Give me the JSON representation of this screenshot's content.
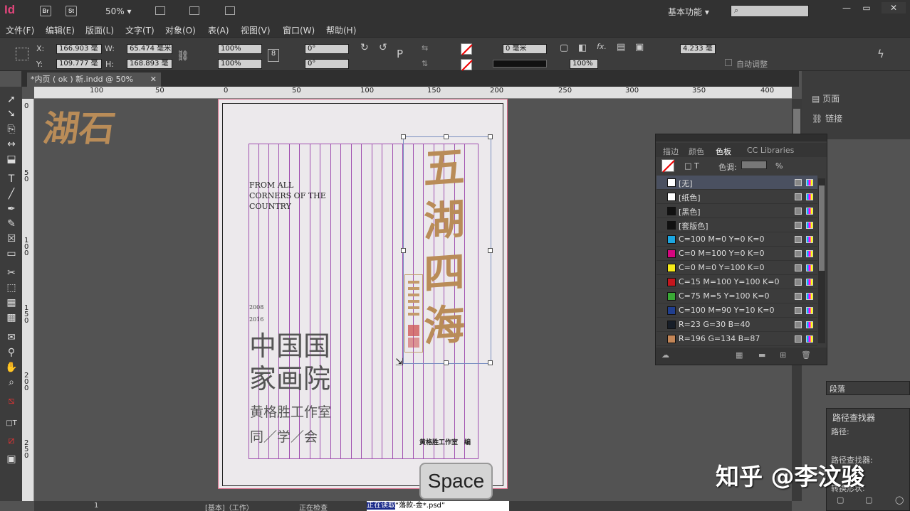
{
  "app": {
    "logo": "Id",
    "bridge": "Br",
    "stock": "St",
    "zoom": "50%",
    "workspace": "基本功能",
    "win_min": "—",
    "win_max": "▭",
    "win_close": "✕"
  },
  "menu": [
    "文件(F)",
    "编辑(E)",
    "版面(L)",
    "文字(T)",
    "对象(O)",
    "表(A)",
    "视图(V)",
    "窗口(W)",
    "帮助(H)"
  ],
  "control": {
    "x_label": "X:",
    "x": "166.903 毫",
    "y_label": "Y:",
    "y": "109.777 毫",
    "w_label": "W:",
    "w": "65.474 毫米",
    "h_label": "H:",
    "h": "168.893 毫",
    "scale_x": "100%",
    "scale_y": "100%",
    "rotate": "0°",
    "shear": "0°",
    "stroke": "0 毫米",
    "opacity": "100%",
    "fx": "fx.",
    "frame_w": "4.233 毫",
    "auto_fit": "自动调整"
  },
  "tab": {
    "title": "*内页 ( ok ) 新.indd @ 50%",
    "close": "✕"
  },
  "ruler_h": [
    "100",
    "50",
    "0",
    "50",
    "100",
    "150",
    "200",
    "250",
    "300",
    "350",
    "400"
  ],
  "ruler_v": [
    "0",
    "50",
    "100",
    "150",
    "200",
    "250"
  ],
  "doc": {
    "calligraphy_left": "湖石",
    "en_line1": "FROM ALL",
    "en_line2": "CORNERS OF THE",
    "en_line3": "COUNTRY",
    "year1": "2008",
    "year2": "2016",
    "title1": "中国国",
    "title2": "家画院",
    "studio": "黄格胜工作室",
    "classmates": "同／学／会",
    "editor": "黄格胜工作室　编",
    "calligraphy_right": "五湖四海"
  },
  "dock": {
    "pages": "页面",
    "links": "链接"
  },
  "swatches": {
    "tabs": [
      "描边",
      "颜色",
      "色板",
      "CC Libraries"
    ],
    "tint_label": "色调:",
    "pct": "%",
    "tint_icon": "T",
    "items": [
      {
        "name": "[无]",
        "color": "#ffffff"
      },
      {
        "name": "[纸色]",
        "color": "#ffffff"
      },
      {
        "name": "[黑色]",
        "color": "#111111"
      },
      {
        "name": "[套版色]",
        "color": "#111111"
      },
      {
        "name": "C=100 M=0 Y=0 K=0",
        "color": "#1ca6e0"
      },
      {
        "name": "C=0 M=100 Y=0 K=0",
        "color": "#d6067f"
      },
      {
        "name": "C=0 M=0 Y=100 K=0",
        "color": "#f6ea1a"
      },
      {
        "name": "C=15 M=100 Y=100 K=0",
        "color": "#c5161d"
      },
      {
        "name": "C=75 M=5 Y=100 K=0",
        "color": "#39a935"
      },
      {
        "name": "C=100 M=90 Y=10 K=0",
        "color": "#203e8e"
      },
      {
        "name": "R=23 G=30 B=40",
        "color": "#171e28"
      },
      {
        "name": "R=196 G=134 B=87",
        "color": "#c48657"
      }
    ]
  },
  "para": {
    "title": "段落"
  },
  "pathfinder": {
    "title": "路径查找器",
    "path": "路径:",
    "pathfinder": "路径查找器:",
    "convert": "转换形状:"
  },
  "status": {
    "page": "1",
    "style": "[基本]（工作）",
    "check": "正在检查"
  },
  "reading": {
    "prefix": "正在读取",
    "file": "“落款-金*.psd”"
  },
  "tooltip": "Space",
  "watermark": "知乎 @李汶骏",
  "colors": {
    "accent": "#e0457b",
    "calligraphy": "#b98c58",
    "guide": "#a050b0"
  }
}
